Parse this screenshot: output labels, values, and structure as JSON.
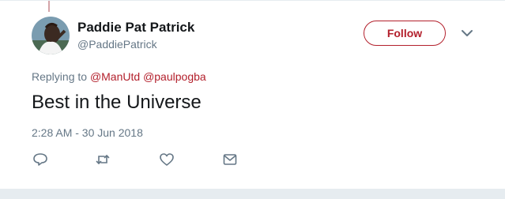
{
  "tweet": {
    "author_name": "Paddie Pat Patrick",
    "author_handle": "@PaddiePatrick",
    "follow_label": "Follow",
    "replying_prefix": "Replying to",
    "mentions": [
      "@ManUtd",
      "@paulpogba"
    ],
    "text": "Best in the Universe",
    "timestamp": "2:28 AM - 30 Jun 2018"
  },
  "icons": {
    "reply": "reply-icon",
    "retweet": "retweet-icon",
    "like": "heart-icon",
    "message": "envelope-icon",
    "more": "chevron-down-icon"
  },
  "colors": {
    "accent": "#b3202c",
    "secondary_text": "#657786",
    "primary_text": "#14171a",
    "background": "#e6ecf0"
  }
}
